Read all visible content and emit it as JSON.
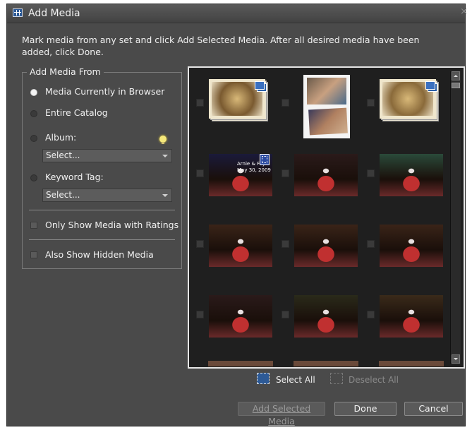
{
  "window": {
    "title": "Add Media",
    "close_glyph": "×"
  },
  "instructions": "Mark media from any set and click Add Selected Media. After all desired media have been added, click Done.",
  "add_media_from": {
    "legend": "Add Media From",
    "options": [
      {
        "label": "Media Currently in Browser",
        "checked": true
      },
      {
        "label": "Entire Catalog",
        "checked": false
      },
      {
        "label": "Album:",
        "checked": false
      },
      {
        "label": "Keyword Tag:",
        "checked": false
      }
    ],
    "album_select": "Select...",
    "keyword_select": "Select...",
    "only_ratings_label": "Only Show Media with Ratings",
    "hidden_media_label": "Also Show Hidden Media"
  },
  "thumbnails": [
    {
      "kind": "stack",
      "tone": "#7a5a30",
      "badge": "stack-icon"
    },
    {
      "kind": "collage",
      "tone": "#d8d8d8",
      "badge": ""
    },
    {
      "kind": "stack",
      "tone": "#8a6a3a",
      "badge": "stack-icon"
    },
    {
      "kind": "video",
      "tone": "#1a1a3a",
      "badge": "video-icon",
      "caption": [
        "Arnie & Fay",
        "May 30, 2009"
      ]
    },
    {
      "kind": "photo",
      "tone": "#2a1a1a",
      "badge": ""
    },
    {
      "kind": "photo",
      "tone": "#2a4a3a",
      "badge": ""
    },
    {
      "kind": "photo",
      "tone": "#3a2418",
      "badge": ""
    },
    {
      "kind": "photo",
      "tone": "#3a2418",
      "badge": ""
    },
    {
      "kind": "photo",
      "tone": "#3a2418",
      "badge": ""
    },
    {
      "kind": "photo",
      "tone": "#2a1a1a",
      "badge": ""
    },
    {
      "kind": "photo",
      "tone": "#2a2a1a",
      "badge": ""
    },
    {
      "kind": "photo",
      "tone": "#3a2a1a",
      "badge": ""
    }
  ],
  "toolbar": {
    "select_all": "Select All",
    "deselect_all": "Deselect All"
  },
  "buttons": {
    "add_selected": "Add Selected Media",
    "done": "Done",
    "cancel": "Cancel"
  },
  "colors": {
    "panel": "#4a4a4a",
    "grid_bg": "#1f1f1f",
    "accent_select": "#2d5a96"
  }
}
